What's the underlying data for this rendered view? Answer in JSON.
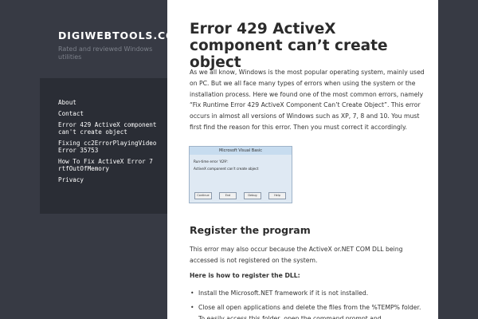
{
  "site": {
    "title": "DIGIWEBTOOLS.COM",
    "description": "Rated and reviewed Windows utilities"
  },
  "nav": {
    "items": [
      "About",
      "Contact",
      "Error 429 ActiveX component can't create object",
      "Fixing cc2ErrorPlayingVideo Error 35753",
      "How To Fix ActiveX Error 7 rtfOutOfMemory",
      "Privacy"
    ]
  },
  "post": {
    "title": "Error 429 ActiveX component can’t create object",
    "intro": "As we all know, Windows is the most popular operating system, mainly used on PC. But we all face many types of errors when using the system or the installation process. Here we found one of the most common errors, namely “Fix Runtime Error 429 ActiveX Component Can’t Create Object”. This error occurs in almost all versions of Windows such as XP, 7, 8 and 10. You must first find the reason for this error. Then you must correct it accordingly.",
    "screenshot": {
      "window_title": "Microsoft Visual Basic",
      "line1": "Run-time error '429':",
      "line2": "ActiveX component can't create object",
      "buttons": [
        "Continue",
        "End",
        "Debug",
        "Help"
      ]
    },
    "section_heading": "Register the program",
    "section_paragraph": "This error may also occur because the ActiveX or.NET COM DLL being accessed is not registered on the system.",
    "howto_heading": "Here is how to register the DLL:",
    "steps": [
      "Install the Microsoft.NET framework if it is not installed.",
      "Close all open applications and delete the files from the %TEMP% folder. To easily access this folder, open the command prompt and"
    ]
  },
  "colors": {
    "page_background": "#373a44",
    "nav_background": "#2a2d35",
    "content_background": "#ffffff"
  }
}
